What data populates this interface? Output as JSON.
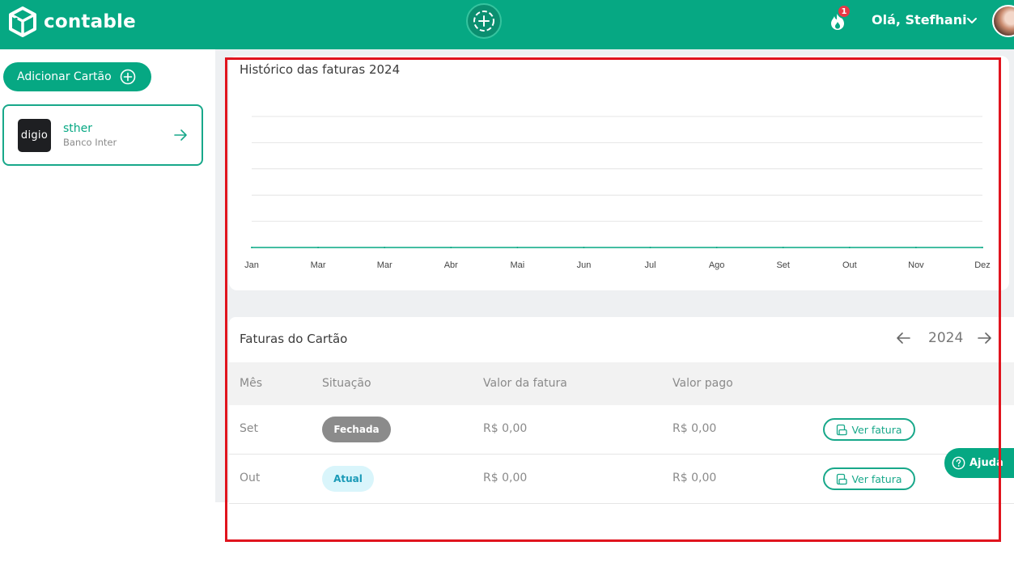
{
  "header": {
    "brand": "contable",
    "notification_count": "1",
    "greeting": "Olá, Stefhani",
    "accent": "#06a883"
  },
  "sidebar": {
    "add_card_label": "Adicionar Cartão",
    "cards": [
      {
        "logo_text": "digio",
        "name": "sther",
        "bank": "Banco Inter"
      }
    ]
  },
  "chart": {
    "title": "Histórico das faturas 2024"
  },
  "chart_data": {
    "type": "line",
    "title": "Histórico das faturas 2024",
    "categories": [
      "Jan",
      "Mar",
      "Mar",
      "Abr",
      "Mai",
      "Jun",
      "Jul",
      "Ago",
      "Set",
      "Out",
      "Nov",
      "Dez"
    ],
    "series": [
      {
        "values": [
          0,
          0,
          0,
          0,
          0,
          0,
          0,
          0,
          0,
          0,
          0,
          0
        ],
        "color": "#06a883"
      }
    ],
    "ylim": [
      0,
      5
    ],
    "grid": true,
    "gridlines": 5
  },
  "invoices": {
    "title": "Faturas do Cartão",
    "year": "2024",
    "columns": [
      "Mês",
      "Situação",
      "Valor da fatura",
      "Valor pago"
    ],
    "rows": [
      {
        "month": "Set",
        "status": "Fechada",
        "status_kind": "closed",
        "invoice_value": "R$ 0,00",
        "paid_value": "R$ 0,00",
        "action": "Ver fatura"
      },
      {
        "month": "Out",
        "status": "Atual",
        "status_kind": "current",
        "invoice_value": "R$ 0,00",
        "paid_value": "R$ 0,00",
        "action": "Ver fatura"
      }
    ]
  },
  "help": {
    "label": "Ajuda"
  }
}
